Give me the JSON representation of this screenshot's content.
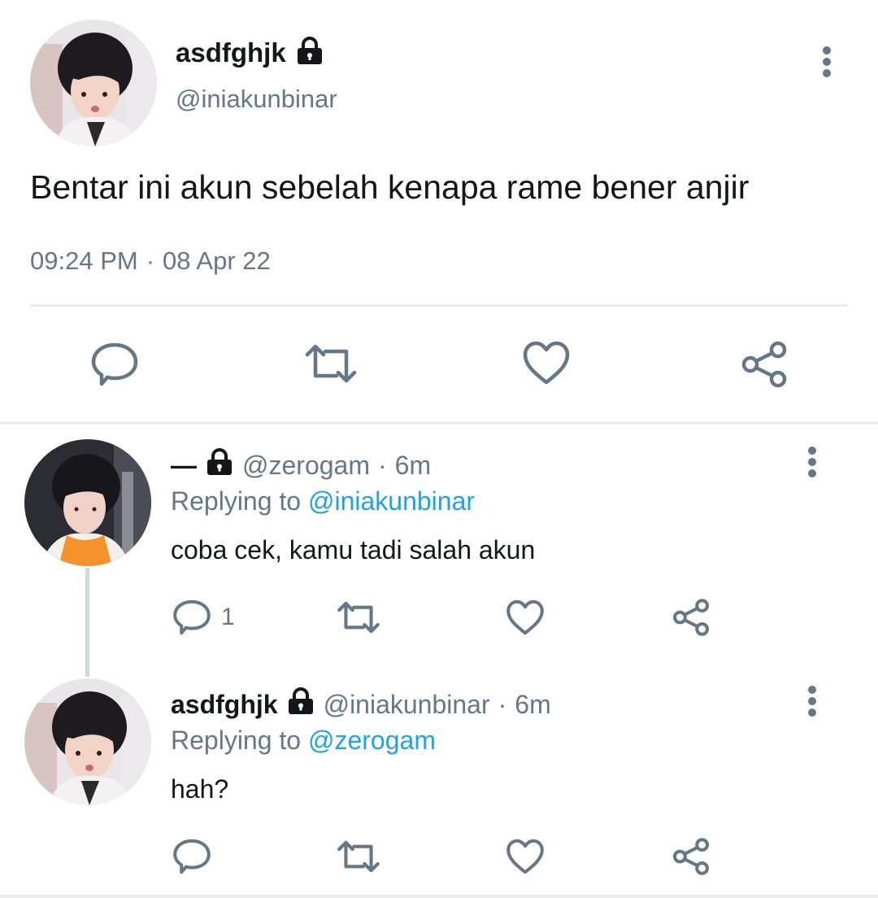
{
  "main_tweet": {
    "name": "asdfghjk",
    "handle": "@iniakunbinar",
    "text": "Bentar ini akun sebelah kenapa rame bener anjir",
    "time": "09:24 PM",
    "separator": "·",
    "date": "08 Apr 22",
    "icons": [
      "lock-icon",
      "more-icon",
      "reply-icon",
      "retweet-icon",
      "like-icon",
      "share-icon"
    ]
  },
  "replies": [
    {
      "name": "—",
      "handle": "@zerogam",
      "separator": "·",
      "time": "6m",
      "replying_prefix": "Replying to",
      "replying_to": "@iniakunbinar",
      "text": "coba cek, kamu tadi salah akun",
      "reply_count": "1"
    },
    {
      "name": "asdfghjk",
      "handle": "@iniakunbinar",
      "separator": "·",
      "time": "6m",
      "replying_prefix": "Replying to",
      "replying_to": "@zerogam",
      "text": "hah?"
    }
  ],
  "colors": {
    "text": "#14171a",
    "secondary": "#657786",
    "link": "#1da1f2",
    "divider": "#e6ecf0"
  }
}
